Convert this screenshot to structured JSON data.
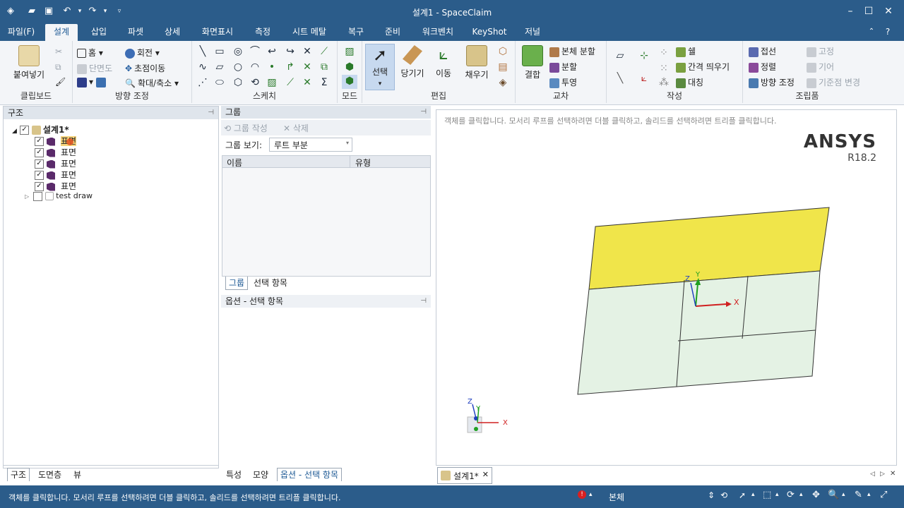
{
  "window": {
    "title": "설계1 - SpaceClaim",
    "accent_color": "#2b5c8a"
  },
  "menu_tabs": [
    {
      "label": "파일(F)",
      "active": false
    },
    {
      "label": "설계",
      "active": true
    },
    {
      "label": "삽입",
      "active": false
    },
    {
      "label": "파셋",
      "active": false
    },
    {
      "label": "상세",
      "active": false
    },
    {
      "label": "화면표시",
      "active": false
    },
    {
      "label": "측정",
      "active": false
    },
    {
      "label": "시트 메탈",
      "active": false
    },
    {
      "label": "복구",
      "active": false
    },
    {
      "label": "준비",
      "active": false
    },
    {
      "label": "워크벤치",
      "active": false
    },
    {
      "label": "KeyShot",
      "active": false
    },
    {
      "label": "저널",
      "active": false
    }
  ],
  "ribbon": {
    "clipboard": {
      "label": "클립보드",
      "paste": "붙여넣기"
    },
    "orient": {
      "label": "방향 조정",
      "home": "홈",
      "section": "단면도",
      "rotate": "회전",
      "pan": "초점이동",
      "zoom": "확대/축소"
    },
    "sketch": {
      "label": "스케치"
    },
    "mode": {
      "label": "모드"
    },
    "edit": {
      "label": "편집",
      "select": "선택",
      "pull": "당기기",
      "move": "이동",
      "fill": "채우기"
    },
    "intersect": {
      "label": "교차",
      "combine": "결합",
      "split_body": "본체 분할",
      "split": "분할",
      "project": "투영"
    },
    "create": {
      "label": "작성",
      "shell": "쉘",
      "offset": "간격 띄우기",
      "mirror": "대칭"
    },
    "assembly": {
      "label": "조립품",
      "tangent": "접선",
      "align": "정렬",
      "orient": "방향 조정",
      "fix": "고정",
      "gear": "기어",
      "anchor": "기준점 변경"
    }
  },
  "structure": {
    "title": "구조",
    "root": "설계1*",
    "items": [
      "표면",
      "표면",
      "표면",
      "표면",
      "표면"
    ],
    "extra": "test draw",
    "tabs": [
      "구조",
      "도면층",
      "뷰"
    ]
  },
  "groups": {
    "title": "그룹",
    "create": "그룹 작성",
    "delete": "삭제",
    "view_label": "그룹 보기:",
    "view_value": "루트 부분",
    "col_name": "이름",
    "col_type": "유형",
    "tabs": [
      "그룹",
      "선택 항목"
    ]
  },
  "options": {
    "title": "옵션 - 선택 항목",
    "tabs": [
      "특성",
      "모양",
      "옵션 - 선택 항목"
    ]
  },
  "viewport": {
    "hint": "객체를 클릭합니다. 모서리 루프를 선택하려면 더블 클릭하고, 솔리드를 선택하려면 트리플 클릭합니다.",
    "brand": "ANSYS",
    "version": "R18.2",
    "doc_tab": "설계1*",
    "axis_x": "X",
    "axis_y": "Y",
    "axis_z": "Z",
    "surface_yellow": "#f0e54a",
    "surface_green": "#e4f2e4"
  },
  "status": {
    "message": "객체를 클릭합니다. 모서리 루프를 선택하려면 더블 클릭하고, 솔리드를 선택하려면 트리플 클릭합니다.",
    "filter": "본체"
  }
}
